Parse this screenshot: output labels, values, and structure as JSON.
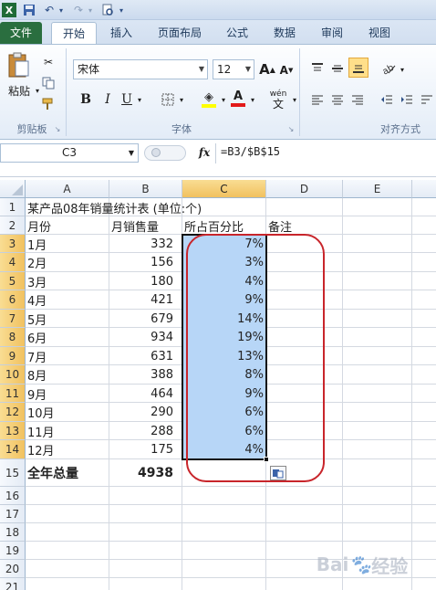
{
  "qat": {
    "icons": [
      "excel-app-icon",
      "save-icon",
      "undo-icon",
      "redo-icon",
      "print-preview-icon"
    ]
  },
  "tabs": [
    "文件",
    "开始",
    "插入",
    "页面布局",
    "公式",
    "数据",
    "审阅",
    "视图"
  ],
  "ribbon": {
    "paste_label": "粘贴",
    "font_name": "宋体",
    "font_size": "12",
    "grow_font": "A",
    "shrink_font": "A",
    "bold": "B",
    "italic": "I",
    "underline": "U",
    "font_color_glyph": "A",
    "pinyin_glyph": "wén",
    "groups": {
      "clipboard": "剪贴板",
      "font": "字体",
      "alignment": "对齐方式"
    }
  },
  "formula_bar": {
    "name_box": "C3",
    "fx": "fx",
    "formula": "=B3/$B$15"
  },
  "columns": [
    "A",
    "B",
    "C",
    "D",
    "E"
  ],
  "rows": [
    "1",
    "2",
    "3",
    "4",
    "5",
    "6",
    "7",
    "8",
    "9",
    "10",
    "11",
    "12",
    "13",
    "14",
    "15",
    "16",
    "17",
    "18",
    "19",
    "20",
    "21"
  ],
  "sheet": {
    "title": "某产品08年销量统计表 (单位:个)",
    "headers": {
      "a": "月份",
      "b": "月销售量",
      "c": "所占百分比",
      "d": "备注"
    },
    "data": [
      {
        "month": "1月",
        "sales": "332",
        "pct": "7%"
      },
      {
        "month": "2月",
        "sales": "156",
        "pct": "3%"
      },
      {
        "month": "3月",
        "sales": "180",
        "pct": "4%"
      },
      {
        "month": "4月",
        "sales": "421",
        "pct": "9%"
      },
      {
        "month": "5月",
        "sales": "679",
        "pct": "14%"
      },
      {
        "month": "6月",
        "sales": "934",
        "pct": "19%"
      },
      {
        "month": "7月",
        "sales": "631",
        "pct": "13%"
      },
      {
        "month": "8月",
        "sales": "388",
        "pct": "8%"
      },
      {
        "month": "9月",
        "sales": "464",
        "pct": "9%"
      },
      {
        "month": "10月",
        "sales": "290",
        "pct": "6%"
      },
      {
        "month": "11月",
        "sales": "288",
        "pct": "6%"
      },
      {
        "month": "12月",
        "sales": "175",
        "pct": "4%"
      }
    ],
    "total_label": "全年总量",
    "total_value": "4938"
  },
  "watermark": "Baidu经验",
  "colors": {
    "selection": "#b7d6f7",
    "annotation": "#c8252b",
    "file_tab": "#2a6e3f"
  }
}
